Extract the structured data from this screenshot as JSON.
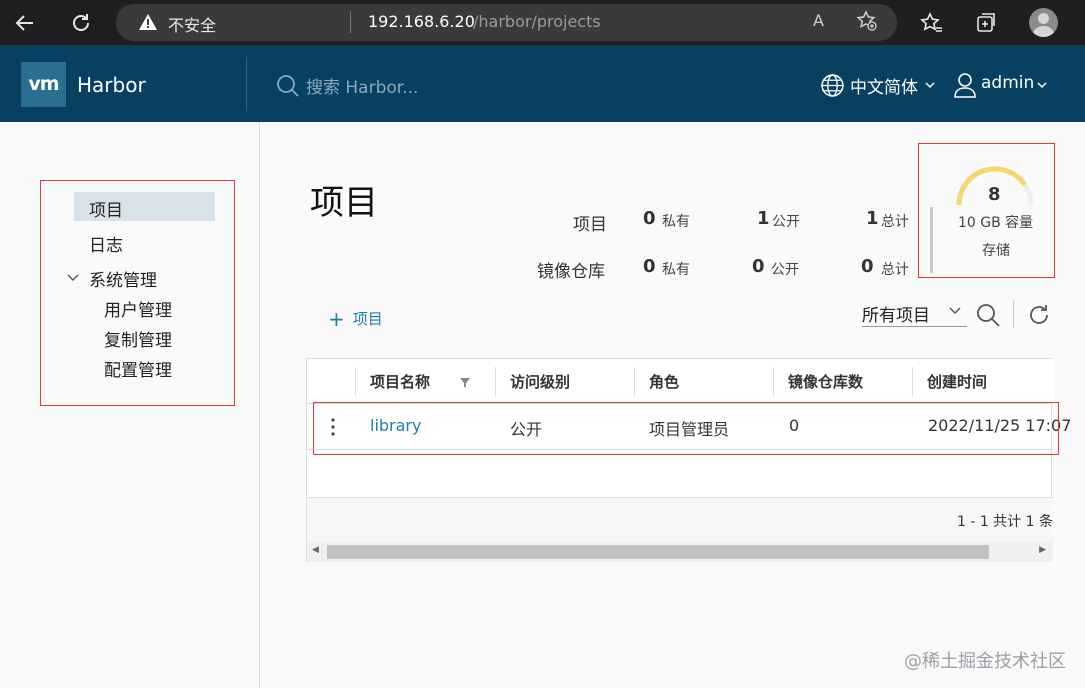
{
  "browser": {
    "security_label": "不安全",
    "url_host": "192.168.6.20",
    "url_path": "/harbor/projects",
    "reader_label": "A"
  },
  "header": {
    "logo": "vm",
    "app_name": "Harbor",
    "search_placeholder": "搜索 Harbor...",
    "language": "中文简体",
    "user": "admin"
  },
  "sidebar": {
    "items": [
      {
        "label": "项目"
      },
      {
        "label": "日志"
      },
      {
        "label": "系统管理"
      },
      {
        "label": "用户管理"
      },
      {
        "label": "复制管理"
      },
      {
        "label": "配置管理"
      }
    ]
  },
  "page": {
    "title": "项目"
  },
  "stats": {
    "projects_label": "项目",
    "registries_label": "镜像仓库",
    "private_label": "私有",
    "public_label": "公开",
    "total_label": "总计",
    "projects_private": "0",
    "projects_public": "1",
    "projects_total": "1",
    "repos_private": "0",
    "repos_public": "0",
    "repos_total": "0"
  },
  "quota": {
    "value": "8",
    "capacity": "10 GB 容量",
    "label": "存储",
    "color": "#f5d76e"
  },
  "toolbar": {
    "add_label": "项目",
    "filter_label": "所有项目"
  },
  "table": {
    "columns": [
      "项目名称",
      "访问级别",
      "角色",
      "镜像仓库数",
      "创建时间"
    ],
    "rows": [
      {
        "name": "library",
        "access": "公开",
        "role": "项目管理员",
        "repo_count": "0",
        "created": "2022/11/25 17:07"
      }
    ],
    "footer": "1 - 1 共计 1 条"
  },
  "watermark": "@稀土掘金技术社区",
  "colors": {
    "header_bg": "#074060",
    "link": "#1a7fad",
    "annotation": "#e03a3a"
  }
}
